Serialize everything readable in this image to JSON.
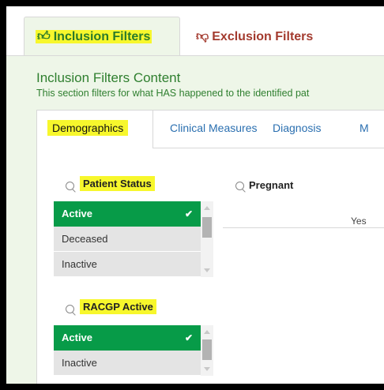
{
  "top_tabs": {
    "inclusion": "Inclusion Filters",
    "exclusion": "Exclusion Filters",
    "inclusion_icon": "thumbs-up-icon",
    "exclusion_icon": "thumbs-down-icon"
  },
  "content": {
    "title": "Inclusion Filters Content",
    "subtitle": "This section filters for what HAS happened to the identified pat"
  },
  "inner_tabs": [
    "Demographics",
    "Clinical Measures",
    "Diagnosis",
    "M"
  ],
  "filters": {
    "patient_status": {
      "label": "Patient Status",
      "items": [
        "Active",
        "Deceased",
        "Inactive"
      ],
      "selected": "Active"
    },
    "pregnant": {
      "label": "Pregnant",
      "column_value": "Yes"
    },
    "racgp_active": {
      "label": "RACGP Active",
      "items": [
        "Active",
        "Inactive"
      ],
      "selected": "Active"
    }
  },
  "colors": {
    "selected_green": "#079b48",
    "highlight": "#f7f72c",
    "link_blue": "#2a6fb0",
    "inclusion_green": "#2a7a2a",
    "exclusion_red": "#a33a2e"
  }
}
